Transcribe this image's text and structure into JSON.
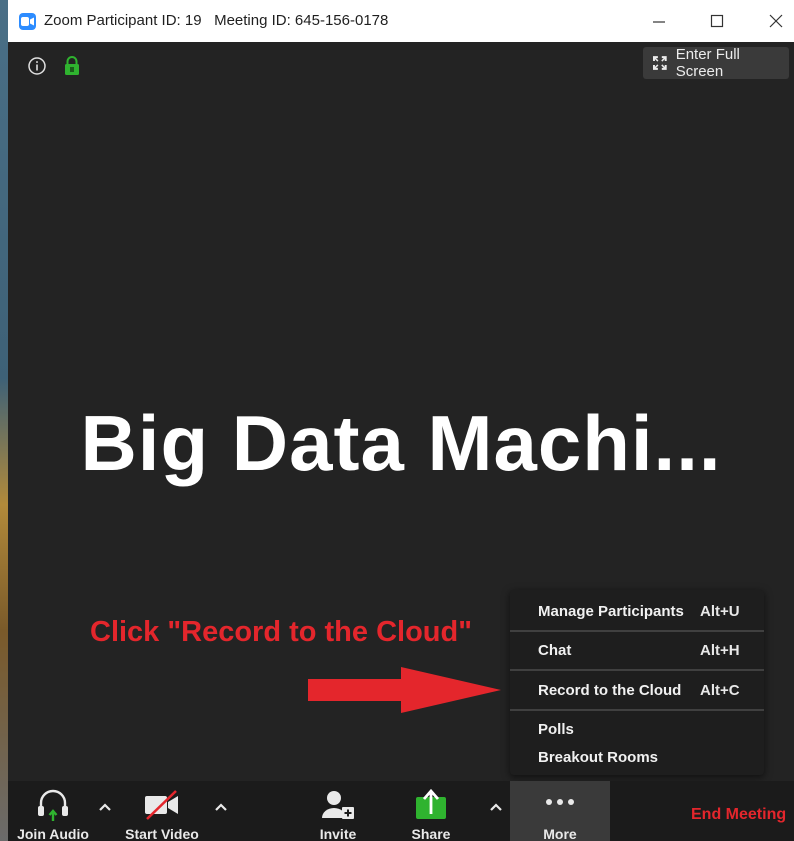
{
  "window": {
    "title": "Zoom Participant ID: 19   Meeting ID: 645-156-0178"
  },
  "top_controls": {
    "fullscreen_label": "Enter Full Screen"
  },
  "screen_share": {
    "text": "Big Data Machi..."
  },
  "annotation": {
    "instruction": "Click \"Record to the Cloud\"",
    "color": "#e4262c"
  },
  "more_menu": {
    "items": [
      {
        "label": "Manage Participants",
        "shortcut": "Alt+U"
      },
      {
        "label": "Chat",
        "shortcut": "Alt+H"
      },
      {
        "label": "Record to the Cloud",
        "shortcut": "Alt+C"
      },
      {
        "label": "Polls",
        "shortcut": ""
      },
      {
        "label": "Breakout Rooms",
        "shortcut": ""
      }
    ]
  },
  "toolbar": {
    "join_audio": "Join Audio",
    "start_video": "Start Video",
    "invite": "Invite",
    "share": "Share",
    "more": "More",
    "end_meeting": "End Meeting"
  },
  "colors": {
    "accent": "#2d8cff",
    "share_green": "#2fb32f",
    "lock_green": "#2fb32f",
    "end_meeting": "#e4262c"
  }
}
